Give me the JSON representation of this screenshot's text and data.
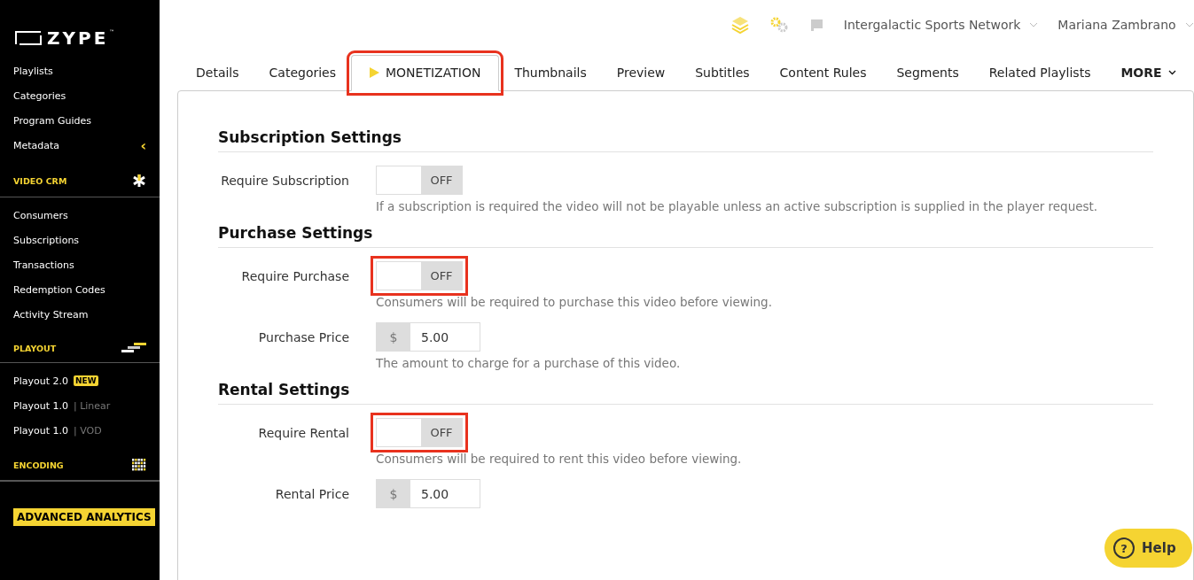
{
  "sidebar": {
    "logo": "ZYPE",
    "logo_mark": "™",
    "groups": [
      {
        "items": [
          {
            "label": "Playlists"
          },
          {
            "label": "Categories"
          },
          {
            "label": "Program Guides"
          },
          {
            "label": "Metadata",
            "caret": "‹"
          }
        ]
      },
      {
        "heading": "VIDEO CRM",
        "items": [
          {
            "label": "Consumers"
          },
          {
            "label": "Subscriptions"
          },
          {
            "label": "Transactions"
          },
          {
            "label": "Redemption Codes"
          },
          {
            "label": "Activity Stream"
          }
        ]
      },
      {
        "heading": "PLAYOUT",
        "items": [
          {
            "label": "Playout 2.0",
            "badge": "NEW"
          },
          {
            "label": "Playout 1.0",
            "sub": "| Linear"
          },
          {
            "label": "Playout 1.0",
            "sub": "| VOD"
          }
        ]
      },
      {
        "heading": "ENCODING"
      }
    ],
    "cta": "ADVANCED ANALYTICS"
  },
  "topbar": {
    "account": "Intergalactic Sports Network",
    "user": "Mariana Zambrano"
  },
  "tabs": [
    {
      "label": "Details",
      "selected": false,
      "highlighted": false
    },
    {
      "label": "Categories",
      "selected": false,
      "highlighted": false
    },
    {
      "label": "MONETIZATION",
      "selected": true,
      "highlighted": true
    },
    {
      "label": "Thumbnails",
      "selected": false,
      "highlighted": false
    },
    {
      "label": "Preview",
      "selected": false,
      "highlighted": false
    },
    {
      "label": "Subtitles",
      "selected": false,
      "highlighted": false
    },
    {
      "label": "Content Rules",
      "selected": false,
      "highlighted": false
    },
    {
      "label": "Segments",
      "selected": false,
      "highlighted": false
    },
    {
      "label": "Related Playlists",
      "selected": false,
      "highlighted": false
    }
  ],
  "more_tab": "MORE",
  "sections": [
    {
      "title": "Subscription Settings",
      "fields": [
        {
          "kind": "toggle",
          "label": "Require Subscription",
          "on": false,
          "state_text": "OFF",
          "highlighted": false,
          "help": "If a subscription is required the video will not be playable unless an active subscription is supplied in the player request."
        }
      ]
    },
    {
      "title": "Purchase Settings",
      "fields": [
        {
          "kind": "toggle",
          "label": "Require Purchase",
          "on": false,
          "state_text": "OFF",
          "highlighted": true,
          "help": "Consumers will be required to purchase this video before viewing."
        },
        {
          "kind": "price",
          "label": "Purchase Price",
          "prefix": "$",
          "value": "5.00",
          "help": "The amount to charge for a purchase of this video."
        }
      ]
    },
    {
      "title": "Rental Settings",
      "fields": [
        {
          "kind": "toggle",
          "label": "Require Rental",
          "on": false,
          "state_text": "OFF",
          "highlighted": true,
          "help": "Consumers will be required to rent this video before viewing."
        },
        {
          "kind": "price",
          "label": "Rental Price",
          "prefix": "$",
          "value": "5.00"
        }
      ]
    }
  ],
  "help_button": "Help",
  "help_glyph": "?"
}
